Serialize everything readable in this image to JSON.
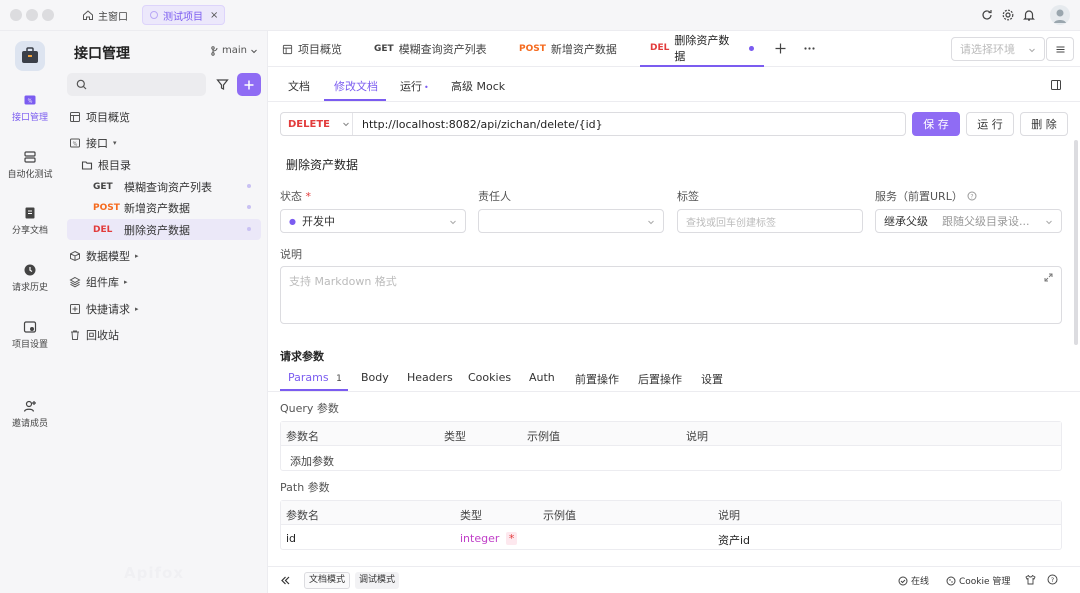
{
  "window": {
    "tabs": [
      {
        "label": "主窗口",
        "active": false
      },
      {
        "label": "测试项目",
        "active": true
      }
    ]
  },
  "rail": {
    "items": [
      {
        "label": "接口管理",
        "active": true
      },
      {
        "label": "自动化测试",
        "active": false
      },
      {
        "label": "分享文档",
        "active": false
      },
      {
        "label": "请求历史",
        "active": false
      },
      {
        "label": "项目设置",
        "active": false
      },
      {
        "label": "邀请成员",
        "active": false
      }
    ],
    "watermark": "Apifox"
  },
  "sidebar": {
    "title": "接口管理",
    "branch": "main",
    "tree": {
      "overview": "项目概览",
      "interfaces": "接口",
      "root": "根目录",
      "apis": [
        {
          "method": "GET",
          "name": "模糊查询资产列表"
        },
        {
          "method": "POST",
          "name": "新增资产数据"
        },
        {
          "method": "DEL",
          "name": "删除资产数据"
        }
      ],
      "models": "数据模型",
      "components": "组件库",
      "quick": "快捷请求",
      "trash": "回收站"
    }
  },
  "tabbar": {
    "overview": "项目概览",
    "tabs": [
      {
        "method": "GET",
        "name": "模糊查询资产列表"
      },
      {
        "method": "POST",
        "name": "新增资产数据"
      },
      {
        "method": "DEL",
        "name": "删除资产数据"
      }
    ],
    "env_placeholder": "请选择环境"
  },
  "subtabs": {
    "doc": "文档",
    "edit": "修改文档",
    "run": "运行",
    "mock": "高级 Mock"
  },
  "request": {
    "method": "DELETE",
    "url": "http://localhost:8082/api/zichan/delete/{id}",
    "save": "保 存",
    "run": "运 行",
    "delete": "删 除"
  },
  "api": {
    "name": "删除资产数据",
    "status_label": "状态",
    "status_value": "开发中",
    "owner_label": "责任人",
    "tags_label": "标签",
    "tags_placeholder": "查找或回车创建标签",
    "service_label": "服务（前置URL）",
    "service_value": "继承父级",
    "service_hint": "跟随父级目录设...",
    "desc_label": "说明",
    "desc_placeholder": "支持 Markdown 格式"
  },
  "params": {
    "section_title": "请求参数",
    "tabs": [
      "Params",
      "Body",
      "Headers",
      "Cookies",
      "Auth",
      "前置操作",
      "后置操作",
      "设置"
    ],
    "params_count": "1",
    "query_title": "Query 参数",
    "query_columns": [
      "参数名",
      "类型",
      "示例值",
      "说明"
    ],
    "query_add": "添加参数",
    "path_title": "Path 参数",
    "path_columns": [
      "参数名",
      "类型",
      "示例值",
      "说明"
    ],
    "path_rows": [
      {
        "name": "id",
        "type": "integer",
        "required": "*",
        "desc": "资产id"
      }
    ]
  },
  "bottom": {
    "doc_mode": "文档模式",
    "debug_mode": "调试模式",
    "online": "在线",
    "cookie": "Cookie 管理"
  },
  "colors": {
    "accent": "#7b5cf0",
    "post": "#f56a1e",
    "delete": "#e23b3b"
  }
}
